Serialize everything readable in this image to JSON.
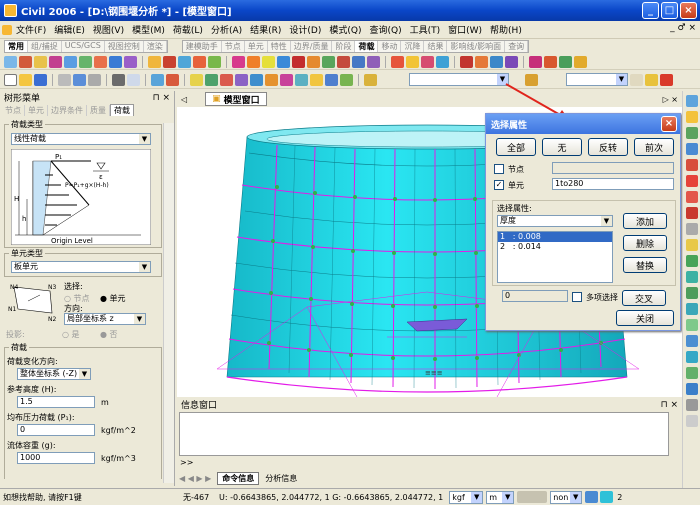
{
  "window": {
    "title": "Civil 2006 - [D:\\钢围堰分析 *] - [模型窗口]"
  },
  "menu": [
    "文件(F)",
    "编辑(E)",
    "视图(V)",
    "模型(M)",
    "荷载(L)",
    "分析(A)",
    "结果(R)",
    "设计(D)",
    "模式(Q)",
    "查询(Q)",
    "工具(T)",
    "窗口(W)",
    "帮助(H)"
  ],
  "menu_controls": "_ ♂ ×",
  "tabs_left": [
    "常用",
    "组/捕捉",
    "UCS/GCS",
    "视图控制",
    "渲染"
  ],
  "tabs_right": [
    "建模助手",
    "节点",
    "单元",
    "特性",
    "边界/质量",
    "阶段",
    "荷载",
    "移动",
    "沉降",
    "结果",
    "影响线/影响面",
    "查询"
  ],
  "tabs_right_active": "荷载",
  "toolbar2": {
    "combo_value": "",
    "combo2_value": ""
  },
  "tree_panel": {
    "title": "树形菜单",
    "pin": "⊓ ×",
    "tabs": [
      "节点",
      "单元",
      "边界条件",
      "质量",
      "荷载"
    ],
    "active_tab": "荷载",
    "load_type_group": "荷载类型",
    "load_type_value": "线性荷载",
    "diagram": {
      "p1": "P₁",
      "eps": "ε",
      "formula": "P=P₁+g×(H-h)",
      "H": "H",
      "h": "h",
      "origin": "Origin Level"
    },
    "elem_type_group": "单元类型",
    "elem_type_value": "板单元",
    "select_label": "选择:",
    "node_opt": "节点",
    "elem_opt": "单元",
    "dir_label": "方向:",
    "dir_value": "局部坐标系 z",
    "proj_label": "投影:",
    "proj_yes": "是",
    "proj_no": "否",
    "n4": "N4",
    "n3": "N3",
    "n1": "N1",
    "n2": "N2",
    "load_group": "荷载",
    "load_dir_label": "荷载变化方向:",
    "load_dir_value": "整体坐标系 (-Z)",
    "ref_height_label": "参考高度 (H):",
    "ref_height_value": "1.5",
    "ref_height_unit": "m",
    "pressure_label": "均布压力荷载 (P₁):",
    "pressure_value": "0",
    "pressure_unit": "kgf/m^2",
    "fluid_label": "流体容重 (g):",
    "fluid_value": "1000",
    "fluid_unit": "kgf/m^3"
  },
  "viewport": {
    "tab": "模型窗口",
    "nav": "▷ ×"
  },
  "info": {
    "title": "信息窗口",
    "pin": "⊓ ×",
    "prompt": ">>",
    "tab_cmd": "命令信息",
    "tab_analysis": "分析信息"
  },
  "dialog": {
    "title": "选择属性",
    "btn_all": "全部",
    "btn_none": "无",
    "btn_invert": "反转",
    "btn_prev": "前次",
    "node_label": "节点",
    "elem_label": "单元",
    "elem_value": "1to280",
    "prop_label": "选择属性:",
    "prop_select": "厚度",
    "list": [
      {
        "id": "1",
        "text": ": 0.008",
        "selected": true
      },
      {
        "id": "2",
        "text": ": 0.014",
        "selected": false
      }
    ],
    "btn_add": "添加",
    "btn_delete": "删除",
    "btn_replace": "替换",
    "btn_intersect": "交叉",
    "count_value": "0",
    "multi_label": "多项选择",
    "btn_close": "关闭"
  },
  "status": {
    "help": "如想找帮助, 请按F1键",
    "none": "无-467",
    "coords": "U: -0.6643865, 2.044772, 1 G: -0.6643865, 2.044772, 1",
    "force_unit": "kgf",
    "length_unit": "m",
    "mode": "non",
    "page": "2"
  },
  "colors": {
    "title_blue": "#0a46c8",
    "shell_cyan": "#22d8e6",
    "beam_magenta": "#e31be8",
    "selected_blue": "#316ac5",
    "arrow_red": "#e0241c"
  }
}
